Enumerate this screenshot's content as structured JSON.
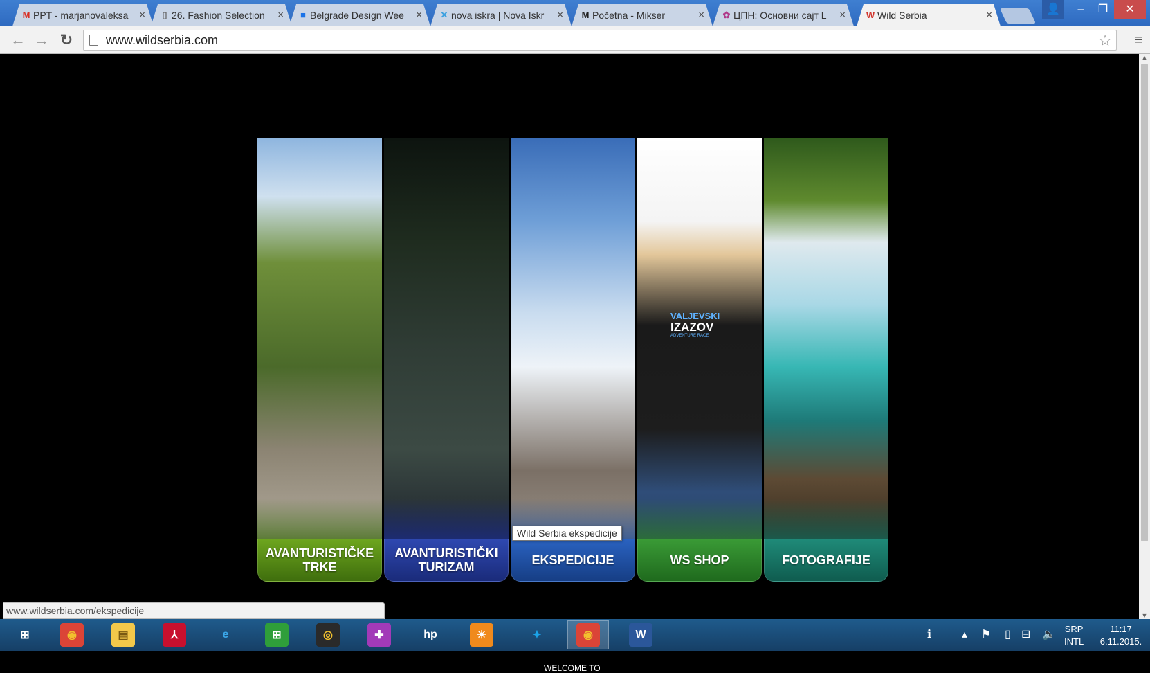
{
  "browser": {
    "tabs": [
      {
        "title": "PPT - marjanovaleksa",
        "favicon": "gmail-icon",
        "fav_glyph": "M",
        "fav_color": "#d93025"
      },
      {
        "title": "26. Fashion Selection",
        "favicon": "page-icon",
        "fav_glyph": "▯",
        "fav_color": "#666666"
      },
      {
        "title": "Belgrade Design Wee",
        "favicon": "bdw-icon",
        "fav_glyph": "■",
        "fav_color": "#1a73e8"
      },
      {
        "title": "nova iskra | Nova Iskr",
        "favicon": "nova-iskra-icon",
        "fav_glyph": "✕",
        "fav_color": "#3aa0e0"
      },
      {
        "title": "Početna - Mikser",
        "favicon": "mikser-icon",
        "fav_glyph": "M",
        "fav_color": "#222222"
      },
      {
        "title": "ЦПН: Основни сајт L",
        "favicon": "cpn-icon",
        "fav_glyph": "✿",
        "fav_color": "#b03a8a"
      },
      {
        "title": "Wild Serbia",
        "favicon": "wild-serbia-icon",
        "fav_glyph": "W",
        "fav_color": "#d0342c",
        "active": true
      }
    ],
    "url": "www.wildserbia.com"
  },
  "page": {
    "panels": [
      {
        "label": "AVANTURISTIČKE TRKE",
        "name": "panel-avanturisticke-trke"
      },
      {
        "label": "AVANTURISTIČKI TURIZAM",
        "name": "panel-avanturisticki-turizam"
      },
      {
        "label": "EKSPEDICIJE",
        "name": "panel-ekspedicije"
      },
      {
        "label": "WS SHOP",
        "name": "panel-ws-shop"
      },
      {
        "label": "FOTOGRAFIJE",
        "name": "panel-fotografije"
      }
    ],
    "shirt_logo": {
      "line1": "VALJEVSKI",
      "line2": "IZAZOV",
      "line3": "ADVENTURE RACE"
    },
    "tooltip": "Wild Serbia ekspedicije",
    "status_url": "www.wildserbia.com/ekspedicije",
    "welcome": "WELCOME TO"
  },
  "taskbar": {
    "apps": [
      {
        "name": "windows-start-icon",
        "glyph": "⊞",
        "color": "#ffffff",
        "bg": "transparent"
      },
      {
        "name": "chrome-icon",
        "glyph": "◉",
        "color": "#f2c12e",
        "bg": "#db4437"
      },
      {
        "name": "file-explorer-icon",
        "glyph": "▤",
        "color": "#7a5a12",
        "bg": "#f3c84a"
      },
      {
        "name": "acrobat-icon",
        "glyph": "⅄",
        "color": "#ffffff",
        "bg": "#c8102e"
      },
      {
        "name": "internet-explorer-icon",
        "glyph": "e",
        "color": "#3aa6e8",
        "bg": "transparent"
      },
      {
        "name": "store-icon",
        "glyph": "⊞",
        "color": "#ffffff",
        "bg": "#2f9e3a"
      },
      {
        "name": "media-player-icon",
        "glyph": "◎",
        "color": "#f2c12e",
        "bg": "#2a2a2a"
      },
      {
        "name": "puzzle-app-icon",
        "glyph": "✚",
        "color": "#ffffff",
        "bg": "#a23ab8"
      },
      {
        "name": "hp-icon",
        "glyph": "hp",
        "color": "#ffffff",
        "bg": "transparent"
      },
      {
        "name": "weather-icon",
        "glyph": "☀",
        "color": "#ffffff",
        "bg": "#f08a1c"
      },
      {
        "name": "telenor-icon",
        "glyph": "✦",
        "color": "#1ba3e8",
        "bg": "transparent"
      },
      {
        "name": "chrome-running-icon",
        "glyph": "◉",
        "color": "#f2c12e",
        "bg": "#db4437",
        "active": true
      },
      {
        "name": "word-icon",
        "glyph": "W",
        "color": "#ffffff",
        "bg": "#2b579a"
      }
    ],
    "tray": {
      "language_1": "SRP",
      "language_2": "INTL",
      "time": "11:17",
      "date": "6.11.2015."
    }
  }
}
